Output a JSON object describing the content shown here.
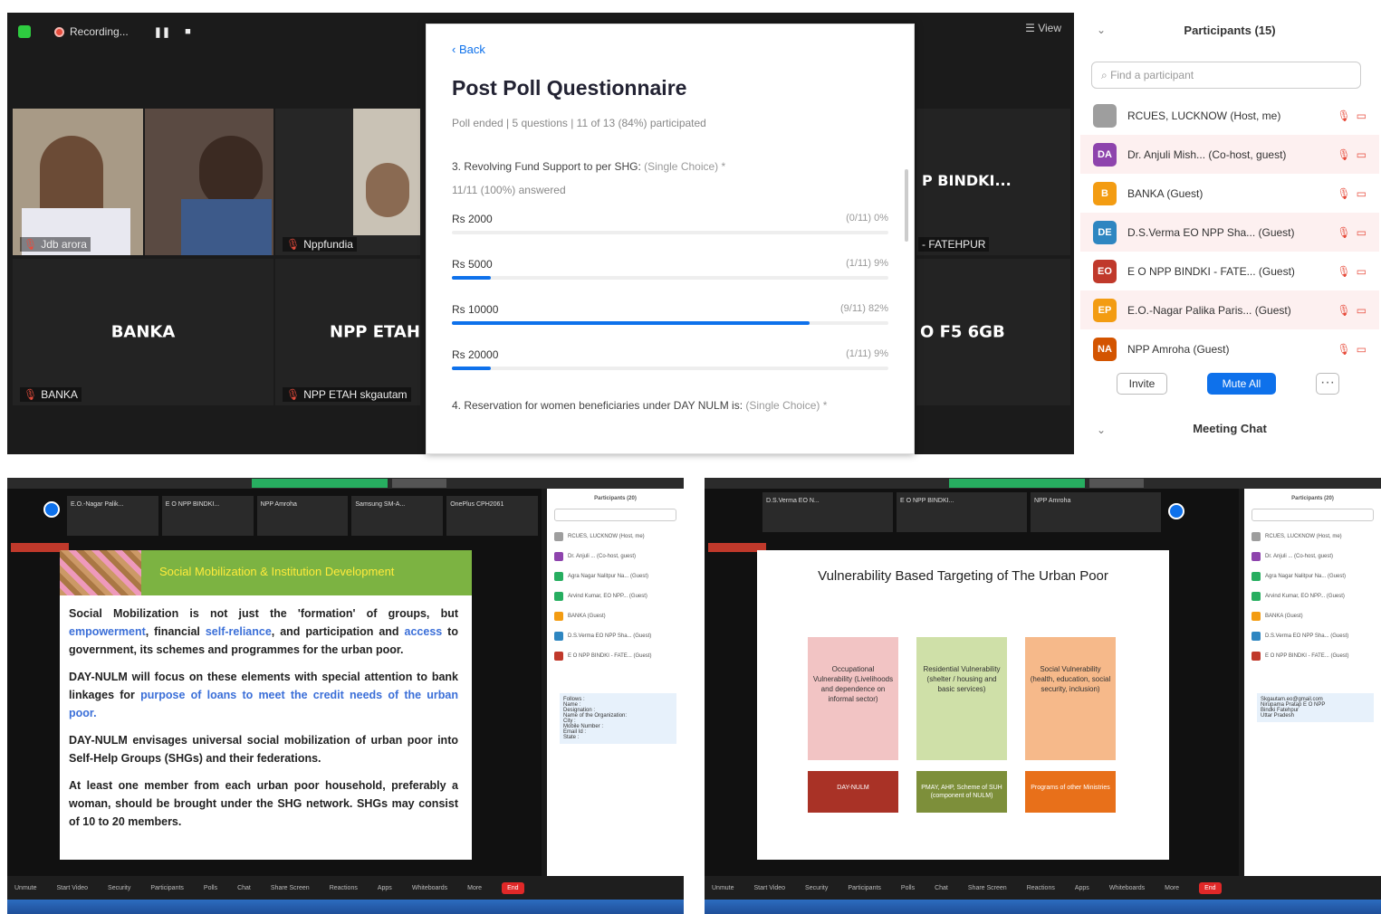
{
  "top": {
    "recording": {
      "label": "Recording...",
      "pause": "❚❚",
      "stop": "■"
    },
    "view_label": "View",
    "tiles": [
      {
        "name": "Jdb arora"
      },
      {
        "name": "Nppfundia"
      },
      {
        "name": "P BINDKI...",
        "sub": "- FATEHPUR"
      },
      {
        "big": "BANKA",
        "name": "BANKA"
      },
      {
        "big": "NPP ETAH",
        "name": "NPP ETAH skgautam"
      },
      {
        "big": "O F5 6GB"
      }
    ],
    "poll": {
      "back": "Back",
      "title": "Post Poll Questionnaire",
      "meta": "Poll ended | 5 questions | 11 of 13 (84%) participated",
      "question": "3. Revolving Fund Support to per SHG:",
      "question_type": "(Single Choice) *",
      "answered": "11/11 (100%) answered",
      "options": [
        {
          "label": "Rs 2000",
          "value": "(0/11) 0%",
          "pct": 0
        },
        {
          "label": "Rs 5000",
          "value": "(1/11) 9%",
          "pct": 9
        },
        {
          "label": "Rs 10000",
          "value": "(9/11) 82%",
          "pct": 82
        },
        {
          "label": "Rs 20000",
          "value": "(1/11) 9%",
          "pct": 9
        }
      ],
      "next_question": "4. Reservation for women beneficiaries under DAY NULM is:",
      "next_question_type": "(Single Choice) *"
    },
    "participants": {
      "header": "Participants (15)",
      "search_placeholder": "Find a participant",
      "list": [
        {
          "initials": "",
          "name": "RCUES, LUCKNOW (Host, me)",
          "color": "#9e9e9e"
        },
        {
          "initials": "DA",
          "name": "Dr. Anjuli Mish... (Co-host, guest)",
          "color": "#8e44ad"
        },
        {
          "initials": "B",
          "name": "BANKA (Guest)",
          "color": "#f39c12"
        },
        {
          "initials": "DE",
          "name": "D.S.Verma EO NPP Sha... (Guest)",
          "color": "#2e86c1"
        },
        {
          "initials": "EO",
          "name": "E O NPP BINDKI - FATE... (Guest)",
          "color": "#c0392b"
        },
        {
          "initials": "EP",
          "name": "E.O.-Nagar Palika Paris... (Guest)",
          "color": "#f39c12"
        },
        {
          "initials": "NA",
          "name": "NPP Amroha (Guest)",
          "color": "#d35400"
        }
      ],
      "invite": "Invite",
      "mute_all": "Mute All",
      "more": "···",
      "chat_header": "Meeting Chat"
    }
  },
  "bottom_left": {
    "strip": [
      "E.O.-Nagar Palik...",
      "E O NPP BINDKI...",
      "NPP Amroha",
      "Samsung SM-A...",
      "OnePlus CPH2061"
    ],
    "slide_title": "Social Mobilization & Institution Development",
    "para1_a": "Social Mobilization is not just the 'formation' of groups, but ",
    "para1_l1": "empowerment",
    "para1_b": ", financial ",
    "para1_l2": "self-reliance",
    "para1_c": ", and participation and ",
    "para1_l3": "access",
    "para1_d": " to government, its schemes and programmes for the urban poor.",
    "para2_a": "DAY-NULM will focus on these elements with special attention to bank linkages for ",
    "para2_l": "purpose of loans to meet the credit needs of the urban poor.",
    "para3": "DAY-NULM envisages universal social mobilization of urban poor into Self-Help Groups (SHGs) and their federations.",
    "para4": "At least one member from each urban poor household, preferably a woman, should be brought under the SHG network. SHGs may consist of 10 to 20 members.",
    "panel_header": "Participants (20)",
    "panel_rows": [
      "RCUES, LUCKNOW (Host, me)",
      "Dr. Anjuli ... (Co-host, guest)",
      "Agra Nagar Nalitpur Na... (Guest)",
      "Arvind Kumar, EO NPP... (Guest)",
      "BANKA (Guest)",
      "D.S.Verma EO NPP Sha... (Guest)",
      "E O NPP BINDKI - FATE... (Guest)"
    ],
    "chat_lines": [
      "Follows :",
      "Name :",
      "Designation :",
      "Name of the Organization:",
      "City :",
      "Mobile Number :",
      "Email Id :",
      "State :"
    ],
    "toolbar": [
      "Unmute",
      "Start Video",
      "Security",
      "Participants",
      "Polls",
      "Chat",
      "Share Screen",
      "Reactions",
      "Apps",
      "Whiteboards",
      "More"
    ],
    "end": "End"
  },
  "bottom_right": {
    "slide_title": "Vulnerability Based Targeting of The Urban Poor",
    "boxes": [
      {
        "text": "Occupational Vulnerability (Livelihoods and dependence on informal sector)",
        "color": "#f2c4c4"
      },
      {
        "text": "Residential Vulnerability (shelter / housing and basic services)",
        "color": "#cfe0a8"
      },
      {
        "text": "Social Vulnerability (health, education, social security, inclusion)",
        "color": "#f6b98a"
      }
    ],
    "bottom_boxes": [
      {
        "text": "DAY-NULM",
        "color": "#a93226"
      },
      {
        "text": "PMAY, AHP, Scheme of SUH (component of NULM)",
        "color": "#7d8f3a"
      },
      {
        "text": "Programs of other Ministries",
        "color": "#e8701a"
      }
    ],
    "strip": [
      "D.S.Verma EO N...",
      "E O NPP BINDKI...",
      "NPP Amroha"
    ],
    "panel_header": "Participants (20)",
    "panel_rows": [
      "RCUES, LUCKNOW (Host, me)",
      "Dr. Anjuli ... (Co-host, guest)",
      "Agra Nagar Nalitpur Na... (Guest)",
      "Arvind Kumar, EO NPP... (Guest)",
      "BANKA (Guest)",
      "D.S.Verma EO NPP Sha... (Guest)",
      "E O NPP BINDKI - FATE... (Guest)"
    ],
    "chat_lines": [
      "Skgautam.eo@gmail.com",
      "Nirupama Pratap E O NPP",
      "Bindki Fatehpur",
      "Uttar Pradesh"
    ],
    "toolbar": [
      "Unmute",
      "Start Video",
      "Security",
      "Participants",
      "Polls",
      "Chat",
      "Share Screen",
      "Reactions",
      "Apps",
      "Whiteboards",
      "More"
    ],
    "end": "End"
  }
}
